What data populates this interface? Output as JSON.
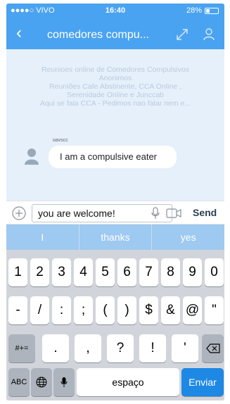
{
  "status": {
    "carrier": "●●●●○ VIVO ",
    "time": "16:40",
    "battery": "28%"
  },
  "nav": {
    "back": "‹",
    "title": "comedores compu..."
  },
  "chat": {
    "banner": [
      "Reunioes online  de Comedores Compulsivos",
      "Anonimos",
      "Reuniões Cafe Abstinente, CCA Online ,",
      "Serenidade Online e Junccab",
      "Aqui se fala CCA - Pedimos nao falar nem e..."
    ],
    "sender": "oavscc",
    "message": "I am a compulsive eater"
  },
  "input": {
    "value": "you are welcome!",
    "send": "Send"
  },
  "suggestions": [
    "I",
    "thanks",
    "yes"
  ],
  "keyboard": {
    "row1": [
      "1",
      "2",
      "3",
      "4",
      "5",
      "6",
      "7",
      "8",
      "9",
      "0"
    ],
    "row2": [
      "-",
      "/",
      ":",
      ";",
      "(",
      ")",
      "$",
      "&",
      "@",
      "\""
    ],
    "row3_left": "#+=",
    "row3": [
      ".",
      ",",
      "?",
      "!",
      "'"
    ],
    "abc": "ABC",
    "space": "espaço",
    "enter": "Enviar"
  },
  "colors": {
    "accent": "#4aa3f0",
    "enter_key": "#1e88e5"
  }
}
